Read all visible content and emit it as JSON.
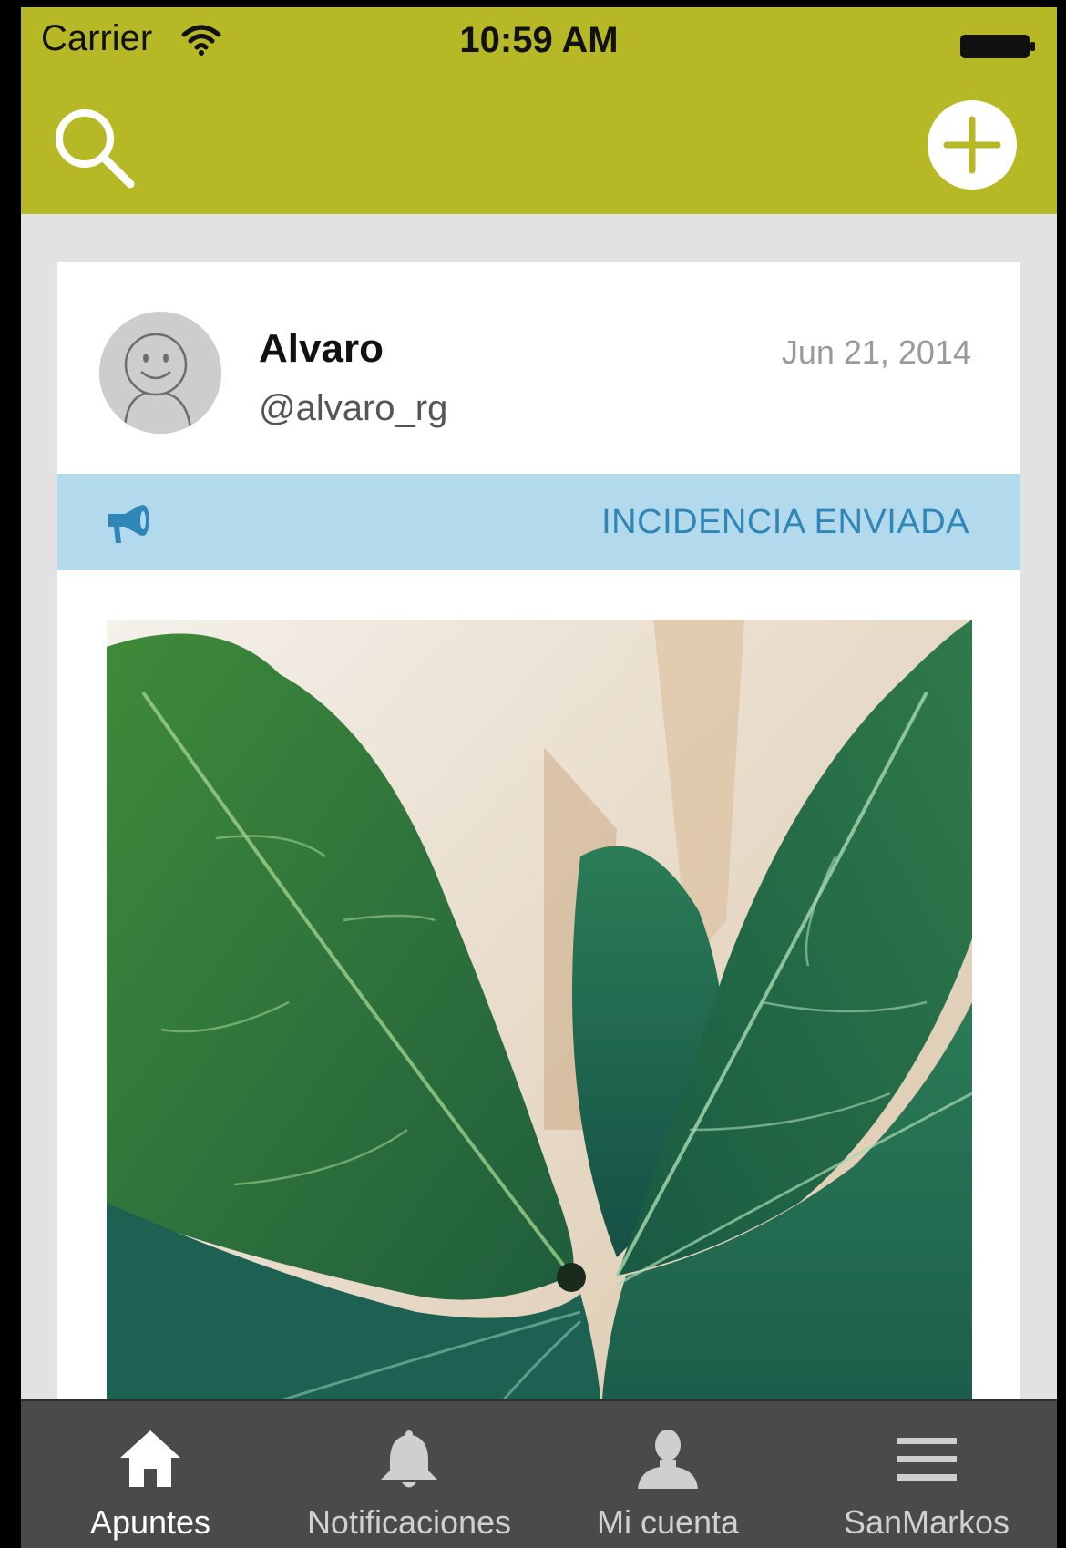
{
  "status_bar": {
    "carrier": "Carrier",
    "time": "10:59 AM"
  },
  "nav": {
    "search_icon": "search-icon",
    "add_icon": "plus-circle-icon",
    "color": "#b6b925"
  },
  "post": {
    "user_name": "Alvaro",
    "user_handle": "@alvaro_rg",
    "date": "Jun 21, 2014",
    "status_label": "INCIDENCIA ENVIADA",
    "status_icon": "megaphone-icon",
    "status_color": "#2f86b8"
  },
  "tabbar": {
    "tabs": [
      {
        "label": "Apuntes",
        "icon": "home-icon",
        "active": true
      },
      {
        "label": "Notificaciones",
        "icon": "bell-icon",
        "active": false
      },
      {
        "label": "Mi cuenta",
        "icon": "person-icon",
        "active": false
      },
      {
        "label": "SanMarkos",
        "icon": "menu-icon",
        "active": false
      }
    ]
  }
}
